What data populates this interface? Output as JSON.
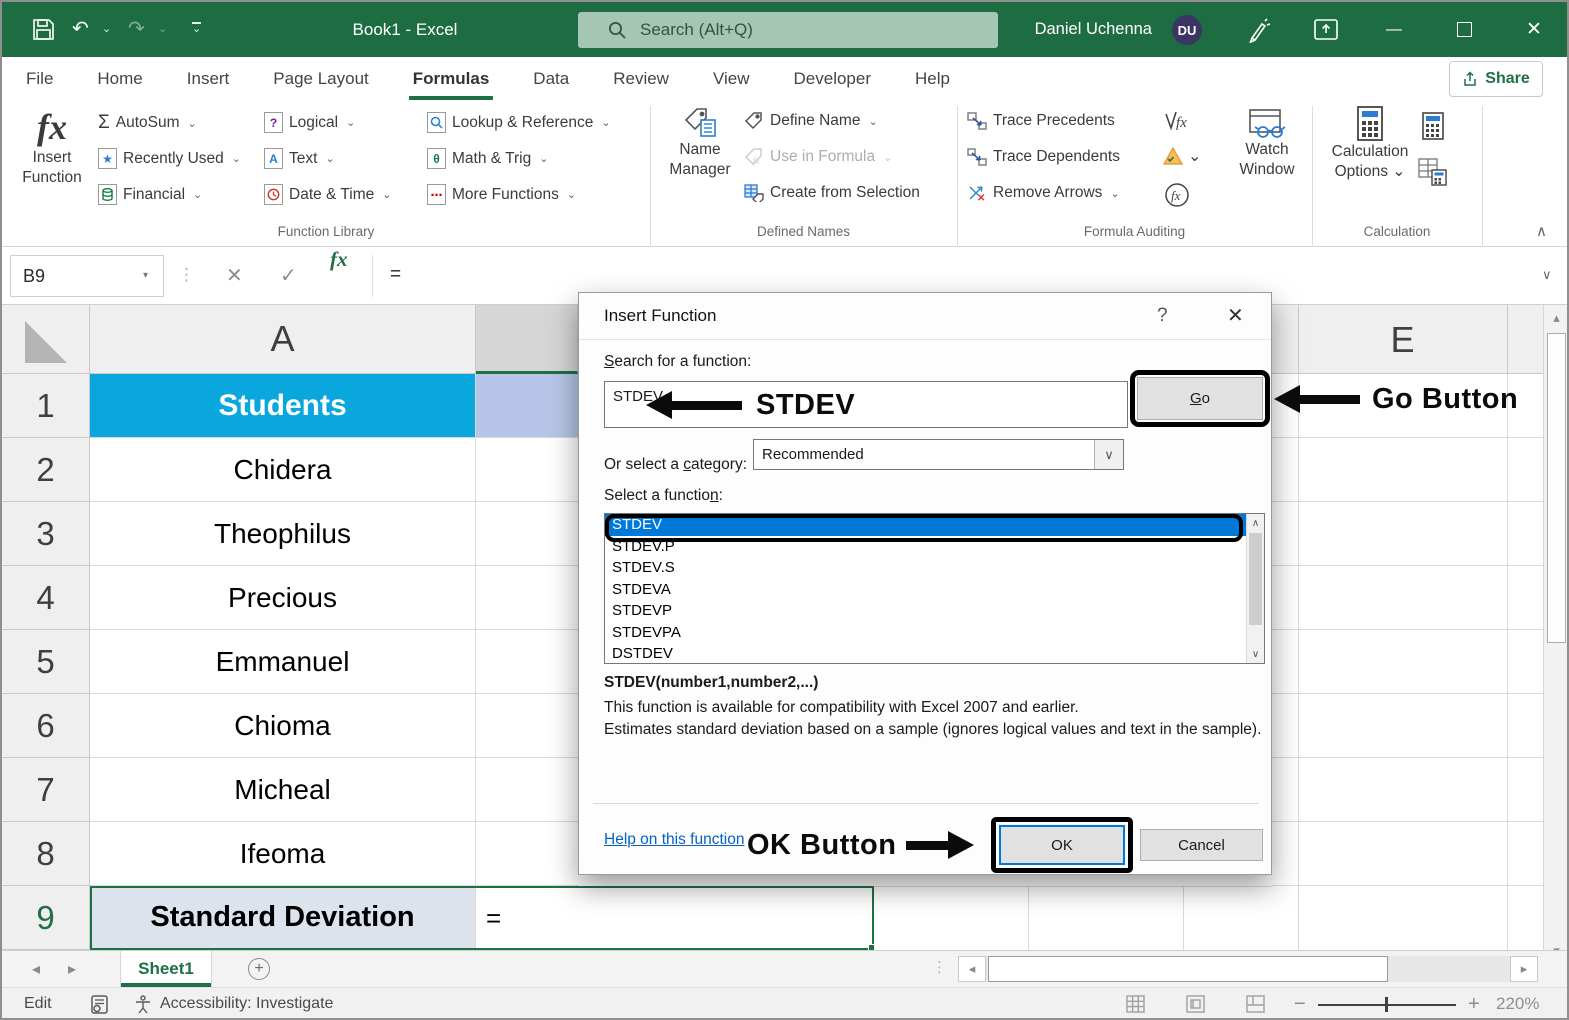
{
  "titlebar": {
    "workbook_title": "Book1 - Excel",
    "search_placeholder": "Search (Alt+Q)",
    "user_name": "Daniel Uchenna",
    "avatar_initials": "DU"
  },
  "ribbon": {
    "tabs": [
      {
        "label": "File"
      },
      {
        "label": "Home"
      },
      {
        "label": "Insert"
      },
      {
        "label": "Page Layout"
      },
      {
        "label": "Formulas"
      },
      {
        "label": "Data"
      },
      {
        "label": "Review"
      },
      {
        "label": "View"
      },
      {
        "label": "Developer"
      },
      {
        "label": "Help"
      }
    ],
    "active_tab": "Formulas",
    "share_label": "Share",
    "function_library": {
      "insert_function_line1": "Insert",
      "insert_function_line2": "Function",
      "autosum": "AutoSum",
      "recently_used": "Recently Used",
      "financial": "Financial",
      "logical": "Logical",
      "text": "Text",
      "date_time": "Date & Time",
      "lookup": "Lookup & Reference",
      "math_trig": "Math & Trig",
      "more_functions": "More Functions",
      "group_label": "Function Library"
    },
    "defined_names": {
      "name_manager_line1": "Name",
      "name_manager_line2": "Manager",
      "define_name": "Define Name",
      "use_in_formula": "Use in Formula",
      "create_from_selection": "Create from Selection",
      "group_label": "Defined Names"
    },
    "formula_auditing": {
      "trace_precedents": "Trace Precedents",
      "trace_dependents": "Trace Dependents",
      "remove_arrows": "Remove Arrows",
      "watch_line1": "Watch",
      "watch_line2": "Window",
      "group_label": "Formula Auditing"
    },
    "calculation": {
      "calc_options_line1": "Calculation",
      "calc_options_line2": "Options",
      "group_label": "Calculation"
    }
  },
  "formula_bar": {
    "name_box": "B9",
    "content": "="
  },
  "sheet": {
    "col_a_header": "A",
    "col_e_header": "E",
    "rows": [
      {
        "num": "1",
        "value": "Students"
      },
      {
        "num": "2",
        "value": "Chidera"
      },
      {
        "num": "3",
        "value": "Theophilus"
      },
      {
        "num": "4",
        "value": "Precious"
      },
      {
        "num": "5",
        "value": "Emmanuel"
      },
      {
        "num": "6",
        "value": "Chioma"
      },
      {
        "num": "7",
        "value": "Micheal"
      },
      {
        "num": "8",
        "value": "Ifeoma"
      },
      {
        "num": "9",
        "value": "Standard Deviation"
      }
    ],
    "b9_value": "=",
    "sheet_tab": "Sheet1"
  },
  "dialog": {
    "title": "Insert Function",
    "search_label": {
      "key": "S",
      "post": "earch for a function:"
    },
    "search_value": "STDEV",
    "go": {
      "key": "G",
      "post": "o"
    },
    "category_label": {
      "pre": "Or select a ",
      "key": "c",
      "post": "ategory:"
    },
    "category_value": "Recommended",
    "select_label": {
      "pre": "Select a functio",
      "key": "n",
      "post": ":"
    },
    "functions": [
      {
        "name": "STDEV"
      },
      {
        "name": "STDEV.P"
      },
      {
        "name": "STDEV.S"
      },
      {
        "name": "STDEVA"
      },
      {
        "name": "STDEVP"
      },
      {
        "name": "STDEVPA"
      },
      {
        "name": "DSTDEV"
      }
    ],
    "signature": "STDEV(number1,number2,...)",
    "description_line1": "This function is available for compatibility with Excel 2007 and earlier.",
    "description_line2": "Estimates standard deviation based on a sample (ignores logical values and text in the sample).",
    "help_link": "Help on this function",
    "ok_label": "OK",
    "cancel_label": "Cancel"
  },
  "annotations": {
    "search_callout": "STDEV",
    "go_callout": "Go Button",
    "ok_callout": "OK Button"
  },
  "status_bar": {
    "mode": "Edit",
    "accessibility": "Accessibility: Investigate",
    "zoom_level": "220%"
  },
  "icons": {
    "caret": "⌄",
    "dropdown": "▾",
    "close": "✕",
    "check": "✓",
    "fx": "fx",
    "help": "?",
    "minimize": "—",
    "sigma": "Σ",
    "star": "★",
    "question": "?",
    "letter_a": "A",
    "theta": "θ",
    "ellipsis": "⋯",
    "plus": "+",
    "minus": "−",
    "up": "▴",
    "down": "▾",
    "left": "◂",
    "right": "▸",
    "chev_up": "∧",
    "chev_down": "∨",
    "dots": "⋮",
    "equals": "="
  },
  "colors": {
    "excel_green": "#1e7145",
    "titlebar_green": "#1e6c42",
    "selection_blue": "#0078d7",
    "students_fill": "#0aa7df",
    "link_blue": "#0563c1"
  }
}
